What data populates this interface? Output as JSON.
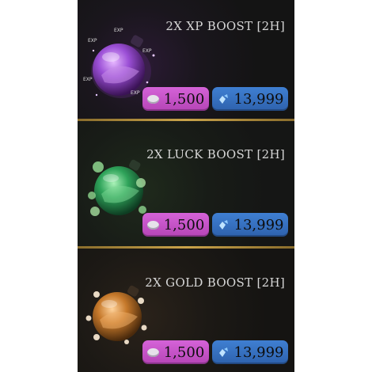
{
  "shop": {
    "items": [
      {
        "title": "2X XP BOOST [2H]",
        "coin_price": "1,500",
        "gem_price": "13,999",
        "orb_color": "#9b4fd6",
        "orb_tags": [
          "EXP",
          "EXP",
          "EXP",
          "EXP",
          "EXP"
        ]
      },
      {
        "title": "2X LUCK BOOST [2H]",
        "coin_price": "1,500",
        "gem_price": "13,999",
        "orb_color": "#2fa35a"
      },
      {
        "title": "2X GOLD BOOST [2H]",
        "coin_price": "1,500",
        "gem_price": "13,999",
        "orb_color": "#c6792b"
      }
    ]
  },
  "colors": {
    "divider": "#c9a34a",
    "coin_button": "#c653c8",
    "gem_button": "#3a72c2"
  }
}
